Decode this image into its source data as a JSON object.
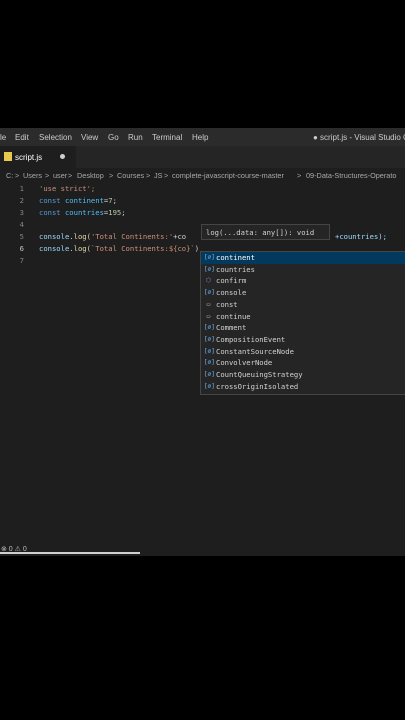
{
  "menu": {
    "items": [
      "le",
      "Edit",
      "Selection",
      "View",
      "Go",
      "Run",
      "Terminal",
      "Help"
    ],
    "title": "● script.js - Visual Studio Co"
  },
  "tab": {
    "filename": "script.js"
  },
  "breadcrumb": [
    "C:",
    ">",
    "Users",
    ">",
    "user",
    ">",
    "Desktop",
    ">",
    "Courses",
    ">",
    "JS",
    ">",
    "complete-javascript-course-master",
    ">",
    "09-Data-Structures-Operato"
  ],
  "lines": [
    "1",
    "2",
    "3",
    "4",
    "5",
    "6",
    "7"
  ],
  "code": {
    "l1": "'use strict';",
    "l2_kw": "const",
    "l2_var": "continent",
    "l2_eq": "=",
    "l2_num": "7",
    "l2_end": ";",
    "l3_kw": "const",
    "l3_var": "countries",
    "l3_eq": "=",
    "l3_num": "195",
    "l3_end": ";",
    "l5_obj": "console",
    "l5_fn": ".log(",
    "l5_str": "'Total Continents:'",
    "l5_mid": "+co",
    "l5_tail": "+countries);",
    "l6_obj": "console",
    "l6_fn": ".log(",
    "l6_str": "`Total Continents:${co}`",
    "l6_end": ")"
  },
  "hint": {
    "signature": "log(...data: any[]): void"
  },
  "suggestions": [
    {
      "label": "continent",
      "icon": "variable-icon"
    },
    {
      "label": "countries",
      "icon": "variable-icon"
    },
    {
      "label": "confirm",
      "icon": "function-icon"
    },
    {
      "label": "console",
      "icon": "variable-icon"
    },
    {
      "label": "const",
      "icon": "keyword-icon"
    },
    {
      "label": "continue",
      "icon": "keyword-icon"
    },
    {
      "label": "Comment",
      "icon": "variable-icon"
    },
    {
      "label": "CompositionEvent",
      "icon": "variable-icon"
    },
    {
      "label": "ConstantSourceNode",
      "icon": "variable-icon"
    },
    {
      "label": "ConvolverNode",
      "icon": "variable-icon"
    },
    {
      "label": "CountQueuingStrategy",
      "icon": "variable-icon"
    },
    {
      "label": "crossOriginIsolated",
      "icon": "variable-icon"
    }
  ],
  "status": {
    "problems": "⊗ 0 ⚠ 0"
  }
}
